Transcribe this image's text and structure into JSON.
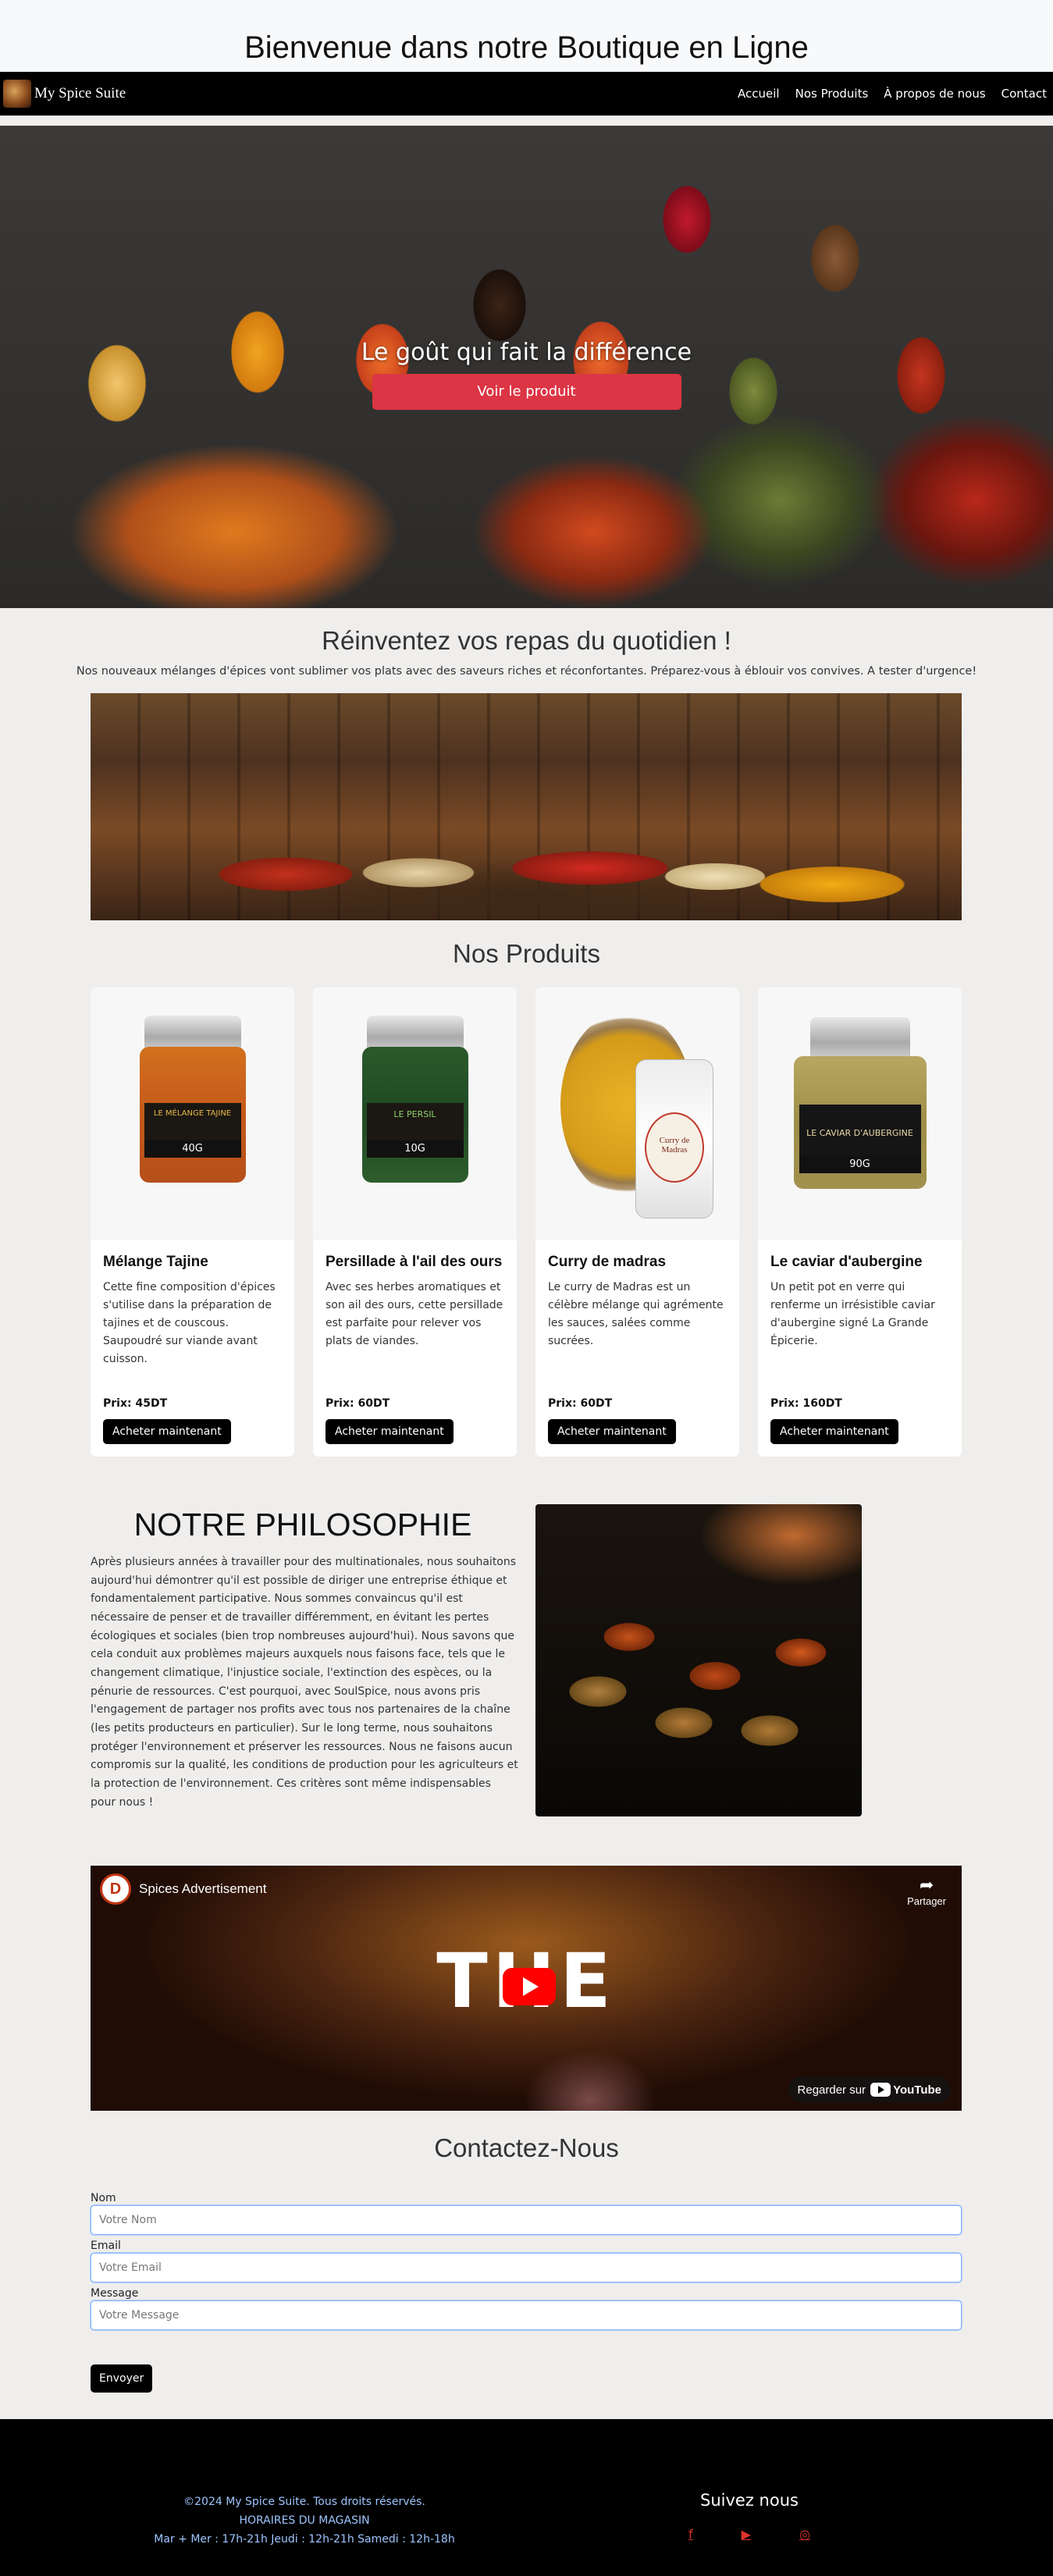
{
  "header": {
    "title": "Bienvenue dans notre Boutique en Ligne"
  },
  "navbar": {
    "brand": "My Spice Suite",
    "links": [
      "Accueil",
      "Nos Produits",
      "À propos de nous",
      "Contact"
    ]
  },
  "hero": {
    "tagline": "Le goût qui fait la différence",
    "button": "Voir le produit"
  },
  "intro": {
    "title": "Réinventez vos repas du quotidien !",
    "text": "Nos nouveaux mélanges d'épices vont sublimer vos plats avec des saveurs riches et réconfortantes. Préparez-vous à éblouir vos convives. A tester d'urgence!"
  },
  "products": {
    "title": "Nos Produits",
    "buy_label": "Acheter maintenant",
    "items": [
      {
        "name": "Mélange Tajine",
        "description": "Cette fine composition d'épices s'utilise dans la préparation de tajines et de couscous. Saupoudré sur viande avant cuisson.",
        "price": "Prix: 45DT",
        "jar_label": "40G",
        "jar_brand": "LE MÉLANGE TAJINE"
      },
      {
        "name": "Persillade à l'ail des ours",
        "description": "Avec ses herbes aromatiques et son ail des ours, cette persillade est parfaite pour relever vos plats de viandes.",
        "price": "Prix: 60DT",
        "jar_label": "10G",
        "jar_brand": "LE PERSIL"
      },
      {
        "name": "Curry de madras",
        "description": "Le curry de Madras est un célèbre mélange qui agrémente les sauces, salées comme sucrées.",
        "price": "Prix: 60DT",
        "tin_label": "Curry de Madras"
      },
      {
        "name": "Le caviar d'aubergine",
        "description": "Un petit pot en verre qui renferme un irrésistible caviar d'aubergine signé La Grande Épicerie.",
        "price": "Prix: 160DT",
        "jar_label": "90G",
        "jar_brand": "LE CAVIAR D'AUBERGINE"
      }
    ]
  },
  "philosophy": {
    "title": "NOTRE PHILOSOPHIE",
    "text": "Après plusieurs années à travailler pour des multinationales, nous souhaitons aujourd'hui démontrer qu'il est possible de diriger une entreprise éthique et fondamentalement participative. Nous sommes convaincus qu'il est nécessaire de penser et de travailler différemment, en évitant les pertes écologiques et sociales (bien trop nombreuses aujourd'hui). Nous savons que cela conduit aux problèmes majeurs auxquels nous faisons face, tels que le changement climatique, l'injustice sociale, l'extinction des espèces, ou la pénurie de ressources. C'est pourquoi, avec SoulSpice, nous avons pris l'engagement de partager nos profits avec tous nos partenaires de la chaîne (les petits producteurs en particulier). Sur le long terme, nous souhaitons protéger l'environnement et préserver les ressources. Nous ne faisons aucun compromis sur la qualité, les conditions de production pour les agriculteurs et la protection de l'environnement. Ces critères sont même indispensables pour nous !"
  },
  "video": {
    "channel_initial": "D",
    "title": "Spices Advertisement",
    "share": "Partager",
    "big_text": "THE",
    "watch_on": "Regarder sur",
    "youtube": "YouTube"
  },
  "contact": {
    "title": "Contactez-Nous",
    "name_label": "Nom",
    "name_placeholder": "Votre Nom",
    "email_label": "Email",
    "email_placeholder": "Votre Email",
    "message_label": "Message",
    "message_placeholder": "Votre Message",
    "submit": "Envoyer"
  },
  "footer": {
    "copyright": "©2024 My Spice Suite. Tous droits réservés.",
    "hours_title": "HORAIRES DU MAGASIN",
    "hours": "Mar + Mer : 17h-21h Jeudi : 12h-21h Samedi : 12h-18h",
    "follow": "Suivez nous",
    "social": [
      "facebook-icon",
      "youtube-icon",
      "instagram-icon"
    ]
  },
  "colors": {
    "accent_red": "#dc3545",
    "nav_bg": "#000000",
    "footer_link": "#9ec5fe",
    "social_red": "#e0332c"
  }
}
